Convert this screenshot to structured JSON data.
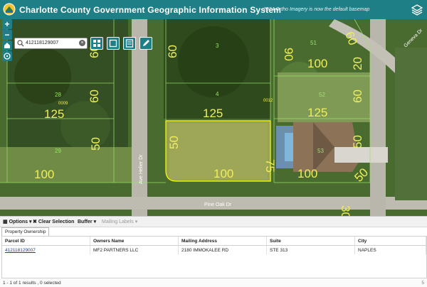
{
  "header": {
    "title": "Charlotte County Government Geographic Information System",
    "notice": "2024 Ortho Imagery is now the default basemap",
    "bg_color": "#1f7f86"
  },
  "search": {
    "value": "412118129007",
    "clear_symbol": "×"
  },
  "map": {
    "street_labels": [
      "Ave Helier Dr",
      "Pine Oak Dr",
      "Geneva Dr"
    ],
    "parcel_labels": [
      "27",
      "28",
      "29",
      "3",
      "4",
      "51",
      "52",
      "53",
      "0009",
      "0012"
    ],
    "dimension_labels": [
      "60",
      "60",
      "50",
      "125",
      "100",
      "60",
      "125",
      "50",
      "75",
      "100",
      "90",
      "100",
      "60",
      "125",
      "50",
      "100",
      "20",
      "60",
      "50",
      "30"
    ],
    "highlight_color": "#ffff00"
  },
  "toolbar": {
    "options": "Options",
    "clear_selection": "Clear Selection",
    "buffer": "Buffer",
    "mailing_labels": "Mailing Labels"
  },
  "tab": {
    "label": "Property Ownership"
  },
  "table": {
    "headers": [
      "Parcel ID",
      "Owners Name",
      "Mailing Address",
      "Suite",
      "City"
    ],
    "rows": [
      [
        "412118129007",
        "MF2 PARTNERS LLC",
        "2180 IMMOKALEE RD",
        "STE 313",
        "NAPLES"
      ]
    ]
  },
  "footer": {
    "count_text": "1 - 1 of 1 results , 0 selected",
    "page_text": "5"
  }
}
